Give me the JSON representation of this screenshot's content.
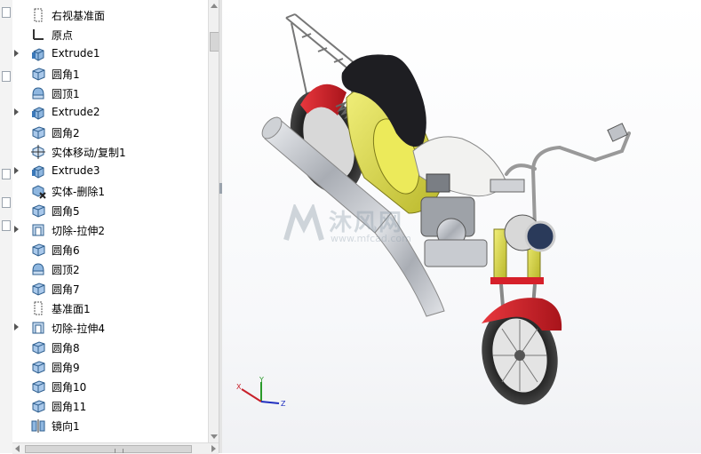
{
  "feature_tree": {
    "items": [
      {
        "label": "右视基准面",
        "icon": "plane-icon",
        "expandable": false
      },
      {
        "label": "原点",
        "icon": "origin-icon",
        "expandable": false
      },
      {
        "label": "Extrude1",
        "icon": "extrude-icon",
        "expandable": true
      },
      {
        "label": "圆角1",
        "icon": "fillet-icon",
        "expandable": false
      },
      {
        "label": "圆顶1",
        "icon": "dome-icon",
        "expandable": false
      },
      {
        "label": "Extrude2",
        "icon": "extrude-icon",
        "expandable": true
      },
      {
        "label": "圆角2",
        "icon": "fillet-icon",
        "expandable": false
      },
      {
        "label": "实体移动/复制1",
        "icon": "move-copy-icon",
        "expandable": false
      },
      {
        "label": "Extrude3",
        "icon": "extrude-icon",
        "expandable": true
      },
      {
        "label": "实体-删除1",
        "icon": "delete-body-icon",
        "expandable": false
      },
      {
        "label": "圆角5",
        "icon": "fillet-icon",
        "expandable": false
      },
      {
        "label": "切除-拉伸2",
        "icon": "cut-extrude-icon",
        "expandable": true
      },
      {
        "label": "圆角6",
        "icon": "fillet-icon",
        "expandable": false
      },
      {
        "label": "圆顶2",
        "icon": "dome-icon",
        "expandable": false
      },
      {
        "label": "圆角7",
        "icon": "fillet-icon",
        "expandable": false
      },
      {
        "label": "基准面1",
        "icon": "plane-icon",
        "expandable": false
      },
      {
        "label": "切除-拉伸4",
        "icon": "cut-extrude-icon",
        "expandable": true
      },
      {
        "label": "圆角8",
        "icon": "fillet-icon",
        "expandable": false
      },
      {
        "label": "圆角9",
        "icon": "fillet-icon",
        "expandable": false
      },
      {
        "label": "圆角10",
        "icon": "fillet-icon",
        "expandable": false
      },
      {
        "label": "圆角11",
        "icon": "fillet-icon",
        "expandable": false
      },
      {
        "label": "镜向1",
        "icon": "mirror-icon",
        "expandable": false
      }
    ]
  },
  "viewport": {
    "model": "motorcycle-model",
    "watermark_text": "沐风网",
    "watermark_url": "www.mfcad.com",
    "triad_labels": {
      "x": "X",
      "y": "Y",
      "z": "Z"
    }
  },
  "colors": {
    "fender_red": "#d6202a",
    "frame_yellow": "#d9d83a",
    "seat_black": "#1e1e22",
    "chrome": "#c8cbd0",
    "icon_blue": "#3b78b8"
  }
}
